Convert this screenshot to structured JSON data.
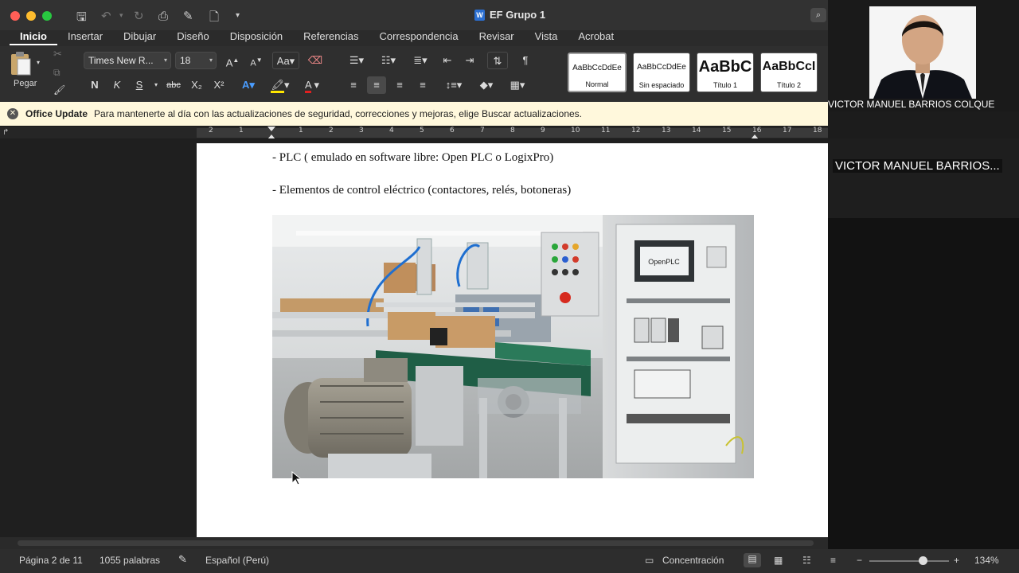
{
  "window": {
    "title": "EF Grupo 1"
  },
  "tabs": [
    "Inicio",
    "Insertar",
    "Dibujar",
    "Diseño",
    "Disposición",
    "Referencias",
    "Correspondencia",
    "Revisar",
    "Vista",
    "Acrobat"
  ],
  "ribbon": {
    "paste_label": "Pegar",
    "font_name": "Times New R...",
    "font_size": "18",
    "bold": "N",
    "italic": "K",
    "underline": "S",
    "strike": "abc",
    "subscript": "X₂",
    "superscript": "X²",
    "styles": [
      {
        "preview": "AaBbCcDdEe",
        "name": "Normal"
      },
      {
        "preview": "AaBbCcDdEe",
        "name": "Sin espaciado"
      },
      {
        "preview": "AaBbC",
        "name": "Título 1"
      },
      {
        "preview": "AaBbCcI",
        "name": "Título 2"
      }
    ]
  },
  "update_bar": {
    "title": "Office Update",
    "message": "Para mantenerte al día con las actualizaciones de seguridad, correcciones y mejoras, elige Buscar actualizaciones."
  },
  "ruler": {
    "ticks": [
      "2",
      "1",
      "1",
      "2",
      "3",
      "4",
      "5",
      "6",
      "7",
      "8",
      "9",
      "10",
      "11",
      "12",
      "13",
      "14",
      "15",
      "16",
      "17",
      "18"
    ]
  },
  "document": {
    "lines": [
      "- PLC ( emulado en software libre: Open PLC o LogixPro)",
      "- Elementos de control eléctrico (contactores, relés, botoneras)"
    ],
    "image_screen_text": "OpenPLC"
  },
  "status_bar": {
    "page": "Página 2 de 11",
    "words": "1055 palabras",
    "language": "Español (Perú)",
    "focus": "Concentración",
    "zoom": "134%",
    "zoom_level": 0.67
  },
  "participants": [
    {
      "name": "VICTOR MANUEL BARRIOS COLQUE"
    },
    {
      "name": "VICTOR MANUEL BARRIOS..."
    }
  ]
}
